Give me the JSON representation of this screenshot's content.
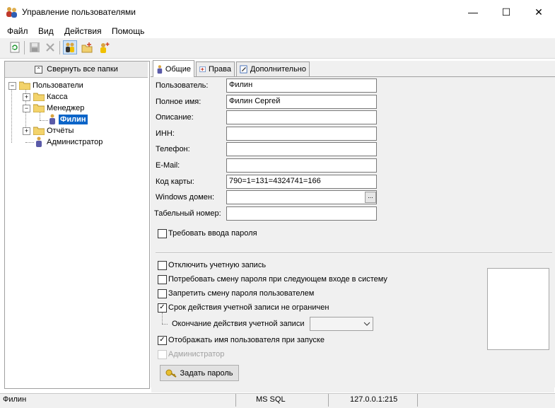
{
  "window": {
    "title": "Управление пользователями",
    "minimize": "—",
    "maximize": "☐",
    "close": "✕"
  },
  "menu": [
    "Файл",
    "Вид",
    "Действия",
    "Помощь"
  ],
  "toolbar": {
    "icons": [
      "refresh-icon",
      "save-icon",
      "delete-icon",
      "users-icon",
      "new-folder-icon",
      "new-user-icon"
    ]
  },
  "tree": {
    "collapse_label": "Свернуть все папки",
    "root": "Пользователи",
    "kassa": "Касса",
    "manager": "Менеджер",
    "filin": "Филин",
    "reports": "Отчёты",
    "admin": "Администратор"
  },
  "tabs": [
    "Общие",
    "Права",
    "Дополнительно"
  ],
  "form": {
    "user_label": "Пользователь:",
    "user_value": "Филин",
    "fullname_label": "Полное имя:",
    "fullname_value": "Филин Сергей",
    "desc_label": "Описание:",
    "desc_value": "",
    "inn_label": "ИНН:",
    "inn_value": "",
    "phone_label": "Телефон:",
    "phone_value": "",
    "email_label": "E-Mail:",
    "email_value": "",
    "card_label": "Код карты:",
    "card_value": "790=1=131=4324741=166",
    "domain_label": "Windows домен:",
    "domain_value": "",
    "domain_btn": "...",
    "tabnum_label": "Табельный номер:",
    "tabnum_value": "",
    "require_password": "Требовать ввода пароля"
  },
  "options": {
    "disable_account": "Отключить учетную запись",
    "require_change": "Потребовать смену пароля при следующем входе в систему",
    "forbid_change": "Запретить смену пароля пользователем",
    "unlimited": "Срок действия учетной записи не ограничен",
    "expiry_label": "Окончание действия учетной записи",
    "show_name": "Отображать имя пользователя при запуске",
    "admin": "Администратор",
    "set_password": "Задать пароль"
  },
  "checks": {
    "require_password": false,
    "disable_account": false,
    "require_change": false,
    "forbid_change": false,
    "unlimited": true,
    "show_name": true,
    "admin": false
  },
  "status": {
    "user": "Филин",
    "db": "MS SQL",
    "server": "127.0.0.1:215"
  }
}
